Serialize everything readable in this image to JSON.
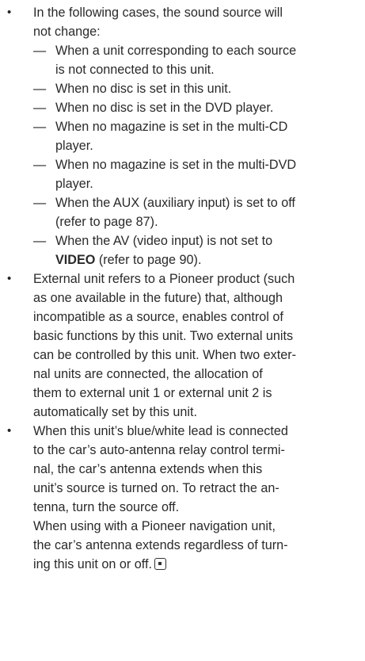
{
  "bullets": [
    {
      "lines": [
        "In the following cases, the sound source will",
        "not change:"
      ],
      "sub_items": [
        {
          "lines": [
            "When a unit corresponding to each source",
            "is not connected to this unit."
          ]
        },
        {
          "lines": [
            "When no disc is set in this unit."
          ]
        },
        {
          "lines": [
            "When no disc is set in the DVD player."
          ]
        },
        {
          "lines": [
            "When no magazine is set in the multi-CD",
            "player."
          ]
        },
        {
          "lines": [
            "When no magazine is set in the multi-DVD",
            "player."
          ]
        },
        {
          "lines": [
            "When the AUX (auxiliary input) is set to off",
            "(refer to page 87)."
          ]
        },
        {
          "line1": "When the AV (video input) is not set to",
          "bold": "VIDEO",
          "line2_rest": " (refer to page 90)."
        }
      ]
    },
    {
      "lines": [
        "External unit refers to a Pioneer product (such",
        "as one available in the future) that, although",
        "incompatible as a source, enables control of",
        "basic functions by this unit. Two external units",
        "can be controlled by this unit. When two exter-",
        "nal units are connected, the allocation of",
        "them to external unit 1 or external unit 2 is",
        "automatically set by this unit."
      ]
    },
    {
      "lines": [
        "When this unit’s blue/white lead is connected",
        "to the car’s auto-antenna relay control termi-",
        "nal, the car’s antenna extends when this",
        "unit’s source is turned on. To retract the an-",
        "tenna, turn the source off.",
        "When using with a Pioneer navigation unit,",
        "the car’s antenna extends regardless of turn-",
        "ing this unit on or off."
      ]
    }
  ],
  "dash": "—"
}
